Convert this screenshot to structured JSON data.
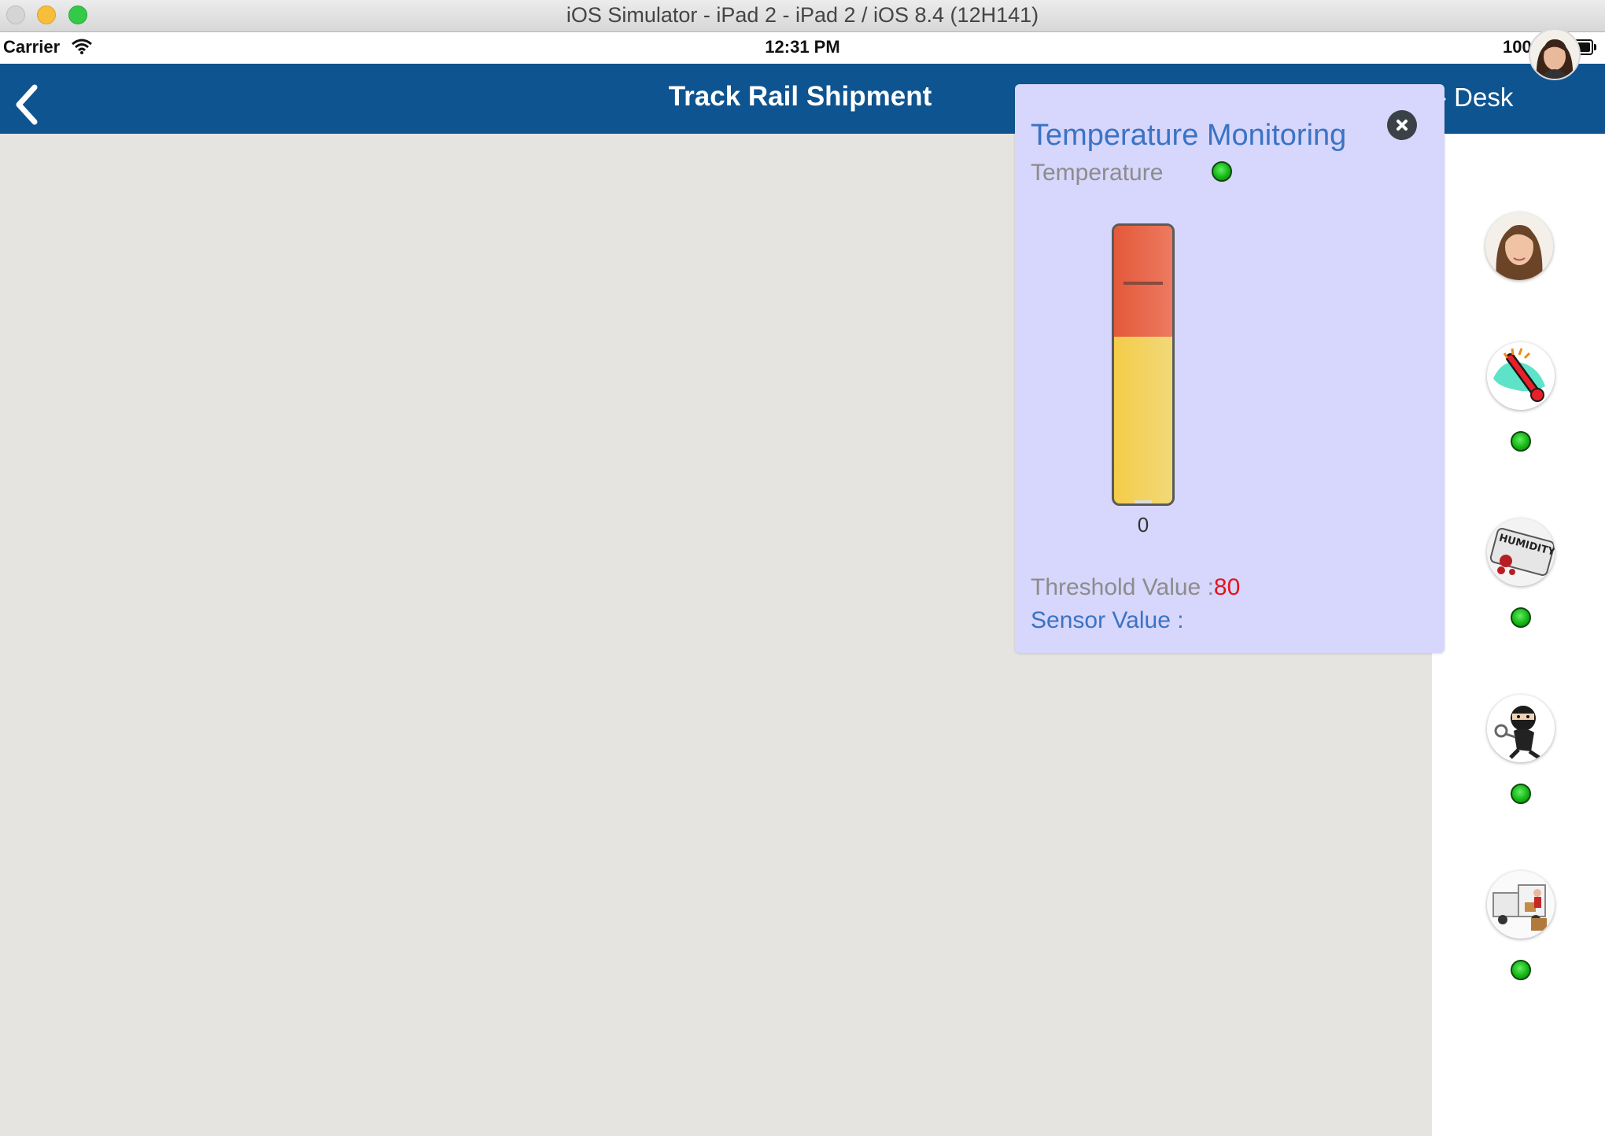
{
  "window": {
    "title": "iOS Simulator - iPad 2 - iPad 2 / iOS 8.4 (12H141)"
  },
  "status_bar": {
    "carrier": "Carrier",
    "time": "12:31 PM",
    "battery_percent": "100%",
    "battery_level": 1.0
  },
  "nav": {
    "title": "Track Rail Shipment",
    "right_label": "› Desk"
  },
  "popover": {
    "title": "Temperature Monitoring",
    "subtitle": "Temperature",
    "status": "green",
    "gauge_min_label": "0",
    "gauge_red_fraction": 0.4,
    "gauge_marker_fraction": 0.8,
    "threshold_label": "Threshold Value :",
    "threshold_value": "80",
    "sensor_label": "Sensor Value :",
    "colors": {
      "title": "#3a73c4",
      "threshold_value": "#e3141c",
      "background": "#d7d6fc",
      "gauge_red": "#e4583a",
      "gauge_yellow": "#f4cc48"
    }
  },
  "sidebar": {
    "items": [
      {
        "icon": "user-profile",
        "has_status": false
      },
      {
        "icon": "thermometer",
        "status": "green",
        "has_status": true
      },
      {
        "icon": "humidity-gauge",
        "status": "green",
        "has_status": true
      },
      {
        "icon": "thief",
        "status": "green",
        "has_status": true
      },
      {
        "icon": "delivery-truck",
        "status": "green",
        "has_status": true
      }
    ]
  },
  "colors": {
    "nav_bar": "#0e5490",
    "status_ok": "#16b616",
    "map_background": "#e5e4e1"
  }
}
